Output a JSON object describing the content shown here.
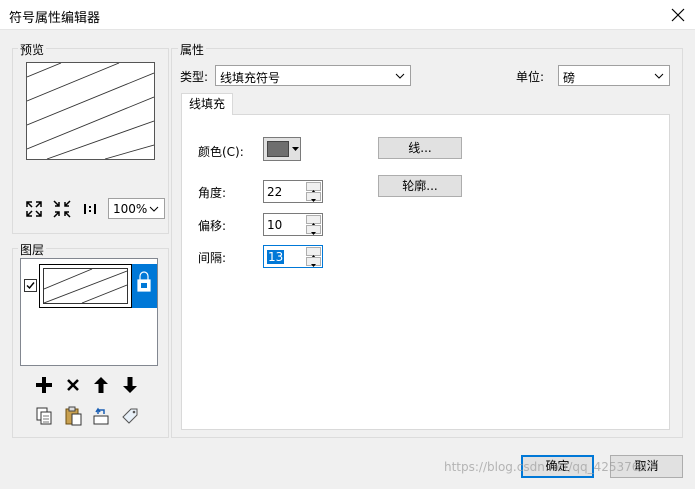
{
  "window": {
    "title": "符号属性编辑器"
  },
  "preview": {
    "group_label": "预览",
    "zoom_value": "100%"
  },
  "layers": {
    "group_label": "图层"
  },
  "properties": {
    "group_label": "属性",
    "type_label": "类型:",
    "type_value": "线填充符号",
    "unit_label": "单位:",
    "unit_value": "磅",
    "tab_label": "线填充",
    "color_label": "颜色(C):",
    "color_value": "#6e6e6e",
    "angle_label": "角度:",
    "angle_value": "22",
    "offset_label": "偏移:",
    "offset_value": "10",
    "spacing_label": "间隔:",
    "spacing_value": "13",
    "line_button": "线...",
    "outline_button": "轮廓..."
  },
  "footer": {
    "ok_label": "确定",
    "cancel_label": "取消",
    "watermark": "https://blog.csdn.net/qq_42537697"
  },
  "colors": {
    "accent": "#0078d7",
    "selection": "#0078d7"
  }
}
